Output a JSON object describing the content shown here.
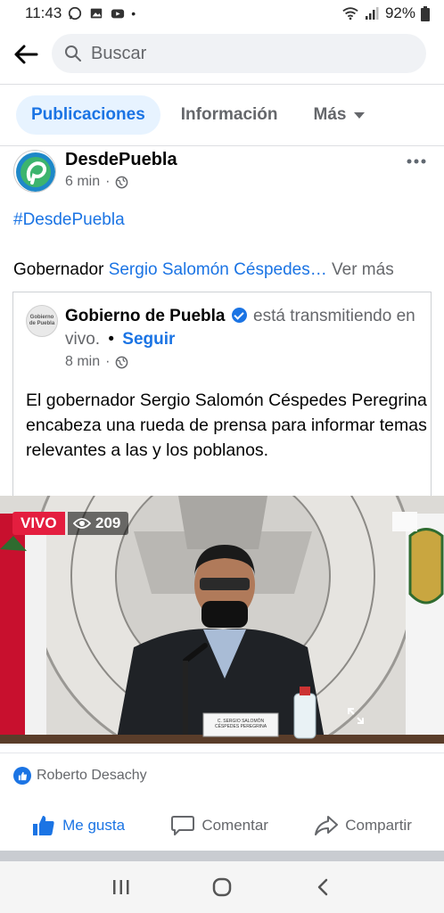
{
  "status_bar": {
    "time": "11:43",
    "battery": "92%"
  },
  "search": {
    "placeholder": "Buscar"
  },
  "tabs": [
    {
      "label": "Publicaciones",
      "active": true
    },
    {
      "label": "Información",
      "active": false
    },
    {
      "label": "Más",
      "active": false
    }
  ],
  "post": {
    "page_name": "DesdePuebla",
    "time": "6 min",
    "hashtag": "#DesdePuebla",
    "text_prefix": "Gobernador ",
    "text_link": "Sergio Salomón Céspedes…",
    "see_more": "Ver más"
  },
  "shared": {
    "avatar_text": "Gobierno de Puebla",
    "name": "Gobierno de Puebla",
    "status": "está transmitiendo en vivo.",
    "separator": "•",
    "follow": "Seguir",
    "time": "8 min",
    "body": "El gobernador Sergio Salomón Céspedes Peregrina encabeza una rueda de prensa para informar temas relevantes a las y los poblanos."
  },
  "video": {
    "live_label": "VIVO",
    "viewers": "209",
    "nameplate_line1": "C. SERGIO SALOMÓN",
    "nameplate_line2": "CÉSPEDES PEREGRINA"
  },
  "reactions": {
    "names": "Roberto Desachy"
  },
  "actions": {
    "like": "Me gusta",
    "comment": "Comentar",
    "share": "Compartir"
  },
  "colors": {
    "facebook_blue": "#1b74e4",
    "live_red": "#e41e3f"
  }
}
